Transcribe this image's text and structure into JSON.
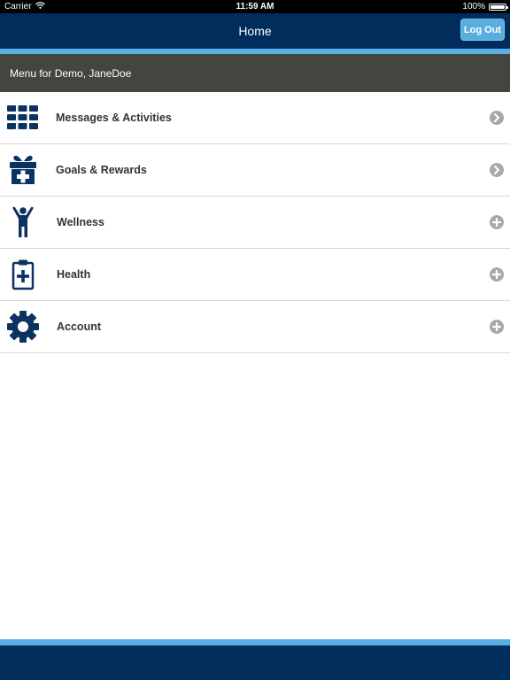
{
  "status_bar": {
    "carrier": "Carrier",
    "time": "11:59 AM",
    "battery_text": "100%",
    "battery_level": 1.0,
    "wifi_icon": "wifi-icon",
    "battery_icon": "battery-icon"
  },
  "nav": {
    "title": "Home",
    "logout_label": "Log Out"
  },
  "menu_header": {
    "title": "Menu for Demo, JaneDoe"
  },
  "menu": {
    "items": [
      {
        "label": "Messages & Activities",
        "icon": "grid-icon",
        "accessory": "chevron-right-icon"
      },
      {
        "label": "Goals & Rewards",
        "icon": "gift-icon",
        "accessory": "chevron-right-icon"
      },
      {
        "label": "Wellness",
        "icon": "person-icon",
        "accessory": "plus-icon"
      },
      {
        "label": "Health",
        "icon": "clipboard-plus-icon",
        "accessory": "plus-icon"
      },
      {
        "label": "Account",
        "icon": "gear-icon",
        "accessory": "plus-icon"
      }
    ]
  },
  "colors": {
    "navy": "#002d5c",
    "accent_blue": "#5aaee3",
    "header_gray": "#444540",
    "accessory_gray": "#a8a8a8",
    "label_text": "#333333"
  }
}
